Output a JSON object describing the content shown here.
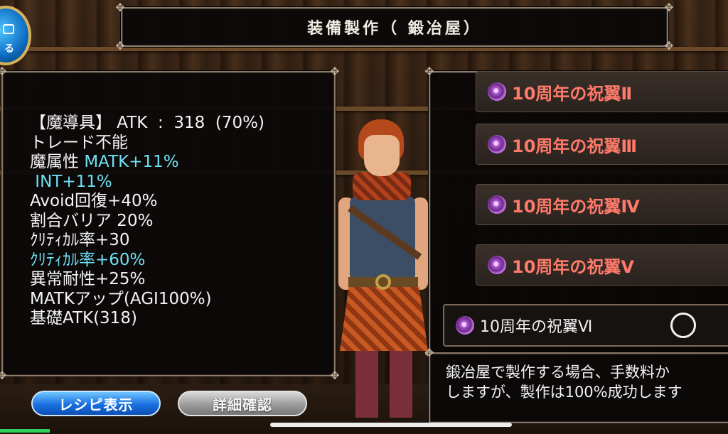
{
  "window": {
    "title": "装備製作（ 鍛冶屋）"
  },
  "menu_button": {
    "label": "る"
  },
  "stats": [
    {
      "text": "【魔導具】 ATK  :  318  (70%)",
      "highlight": false
    },
    {
      "text": "トレード不能",
      "highlight": false
    },
    {
      "text": "魔属性 ",
      "highlight": false,
      "suffix": "MATK+11%"
    },
    {
      "text": " INT+11%",
      "highlight": true
    },
    {
      "text": "Avoid回復+40%",
      "highlight": false
    },
    {
      "text": "割合バリア 20%",
      "highlight": false
    },
    {
      "text": "ｸﾘﾃｨｶﾙ率+30",
      "highlight": false
    },
    {
      "text": "ｸﾘﾃｨｶﾙ率+60%",
      "highlight": true
    },
    {
      "text": "異常耐性+25%",
      "highlight": false
    },
    {
      "text": "MATKアップ(AGI100%)",
      "highlight": false
    },
    {
      "text": "基礎ATK(318)",
      "highlight": false
    }
  ],
  "buttons": {
    "recipe_label": "レシピ表示",
    "detail_label": "詳細確認"
  },
  "recipe_list": {
    "items": [
      {
        "label": "10周年の祝翼Ⅱ",
        "selected": false
      },
      {
        "label": "10周年の祝翼Ⅲ",
        "selected": false
      },
      {
        "label": "10周年の祝翼Ⅳ",
        "selected": false
      },
      {
        "label": "10周年の祝翼Ⅴ",
        "selected": false
      },
      {
        "label": "10周年の祝翼Ⅵ",
        "selected": true
      }
    ]
  },
  "info": {
    "line1": "鍛冶屋で製作する場合、手数料か",
    "line2": "しますが、製作は100%成功します"
  },
  "colors": {
    "item_label": "#ff7a6a",
    "stat_highlight": "#6fe0f2",
    "recipe_button": "#1a6fe0",
    "detail_button": "#9c9c9c"
  }
}
